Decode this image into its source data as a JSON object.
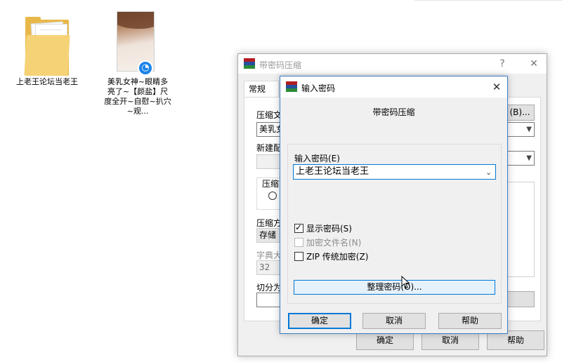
{
  "desktop": {
    "icon1": {
      "label": "上老王论坛当老王"
    },
    "icon2": {
      "label": "美乳女神~眼睛多亮了~【颜盐】尺度全开~自慰~扒穴~观..."
    }
  },
  "back_window": {
    "title": "带密码压缩",
    "help": "?",
    "close": "✕",
    "tab_general": "常规",
    "label_archive_name": "压缩文",
    "archive_name_value": "美乳女",
    "label_new_profile": "新建配",
    "label_compress_group": "压缩",
    "label_method": "压缩方",
    "method_value": "存储",
    "label_dict": "字典大",
    "dict_value": "32",
    "label_split": "切分为",
    "browse_button": "(B)...",
    "ok": "确定",
    "cancel": "取消",
    "help_button": "帮助"
  },
  "dialog": {
    "title": "输入密码",
    "close": "✕",
    "heading": "带密码压缩",
    "password_label": "输入密码(E)",
    "password_value": "上老王论坛当老王",
    "show_password": "显示密码(S)",
    "encrypt_filenames": "加密文件名(N)",
    "zip_legacy": "ZIP 传统加密(Z)",
    "organize_button": "整理密码(O)...",
    "ok": "确定",
    "cancel": "取消",
    "help": "帮助",
    "show_password_checked": true,
    "encrypt_filenames_enabled": false,
    "zip_legacy_checked": false
  },
  "colors": {
    "accent": "#0078d7",
    "winrar_red": "#b01e23",
    "winrar_blue": "#2450a0",
    "winrar_green": "#2a8a3a",
    "folder": "#f6d277"
  }
}
